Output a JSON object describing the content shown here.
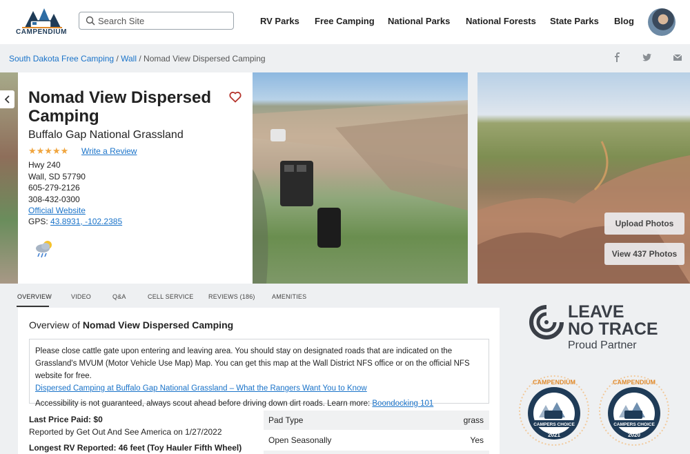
{
  "header": {
    "logo_text": "CAMPENDIUM",
    "search_placeholder": "Search Site",
    "nav": [
      "RV Parks",
      "Free Camping",
      "National Parks",
      "National Forests",
      "State Parks",
      "Blog"
    ]
  },
  "breadcrumb": {
    "items": [
      "South Dakota Free Camping",
      "Wall"
    ],
    "current": "Nomad View Dispersed Camping",
    "separator": "/"
  },
  "share_icons": [
    "facebook-icon",
    "twitter-icon",
    "email-icon"
  ],
  "listing": {
    "title": "Nomad View Dispersed Camping",
    "subtitle": "Buffalo Gap National Grassland",
    "stars": "★★★★★",
    "rating": 5,
    "review_link": "Write a Review",
    "address1": "Hwy 240",
    "address2": "Wall, SD 57790",
    "phone1": "605-279-2126",
    "phone2": "308-432-0300",
    "website": "Official Website",
    "gps_label": "GPS:",
    "gps": "43.8931, -102.2385",
    "weather_icon": "rain-sun-icon"
  },
  "photos": {
    "upload_label": "Upload Photos",
    "view_label": "View 437 Photos"
  },
  "tabs": [
    "OVERVIEW",
    "VIDEO",
    "Q&A",
    "CELL SERVICE",
    "REVIEWS (186)",
    "AMENITIES"
  ],
  "overview": {
    "title_prefix": "Overview of",
    "title_name": "Nomad View Dispersed Camping",
    "notice_text": "Please close cattle gate upon entering and leaving area. You should stay on designated roads that are indicated on the Grassland's MVUM (Motor Vehicle Use Map) Map. You can get this map at the Wall District NFS office or on the official NFS website for free.",
    "notice_link": "Dispersed Camping at Buffalo Gap National Grassland – What the Rangers Want You to Know",
    "access_text": "Accessibility is not guaranteed, always scout ahead before driving down dirt roads. Learn more:",
    "access_link": "Boondocking 101",
    "last_price_label": "Last Price Paid:",
    "last_price": "$0",
    "reported_by": "Reported by Get Out And See America on 1/27/2022",
    "longest_rv_label": "Longest RV Reported:",
    "longest_rv": "46 feet (Toy Hauler Fifth Wheel)",
    "details": [
      {
        "key": "Pad Type",
        "value": "grass"
      },
      {
        "key": "Open Seasonally",
        "value": "Yes"
      }
    ]
  },
  "sidebar": {
    "lnt_line1": "LEAVE",
    "lnt_line2": "NO TRACE",
    "lnt_line3": "Proud Partner",
    "badges": [
      {
        "brand": "CAMPENDIUM",
        "label": "CAMPERS CHOICE",
        "year": "2021"
      },
      {
        "brand": "CAMPENDIUM",
        "label": "CAMPERS CHOICE",
        "year": "2020"
      }
    ]
  },
  "colors": {
    "link": "#1a73c9",
    "star": "#f0a640",
    "heart": "#b5342c",
    "lnt": "#3a3f47",
    "badge_navy": "#1f3b57",
    "badge_orange": "#e08a2c"
  }
}
